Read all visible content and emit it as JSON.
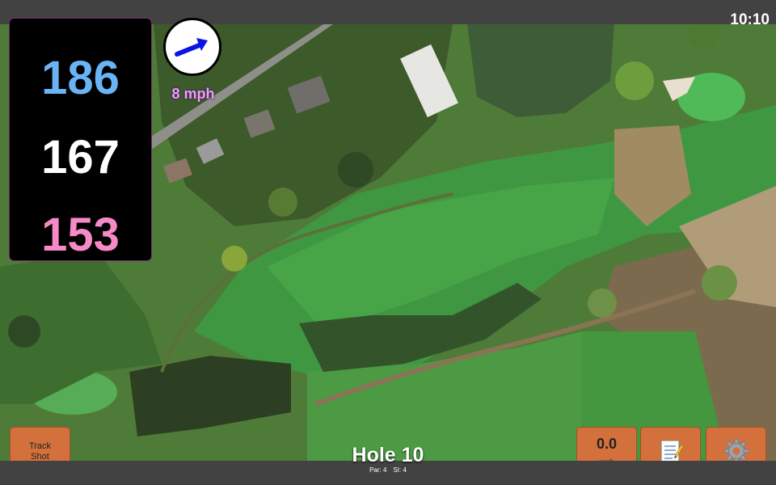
{
  "status_bar": {
    "time": "10:10"
  },
  "distances": {
    "back": "186",
    "center": "167",
    "front": "153"
  },
  "wind": {
    "speed_label": "8 mph",
    "arrow_icon": "wind-direction-arrow-icon",
    "arrow_color": "#0a14e6"
  },
  "buttons": {
    "track_shot": {
      "line1": "Track",
      "line2": "Shot"
    },
    "wind_readout": {
      "value": "0.0",
      "unit": "mph"
    },
    "notes": {
      "icon": "notepad-icon"
    },
    "settings": {
      "icon": "gear-icon"
    },
    "accent_color": "#d4703c"
  },
  "hole": {
    "title": "Hole 10",
    "par": "Par: 4",
    "si": "SI: 4"
  },
  "colors": {
    "back_distance": "#6ab4f6",
    "center_distance": "#ffffff",
    "front_distance": "#f68ac7",
    "wind_label": "#e2a6f0"
  }
}
